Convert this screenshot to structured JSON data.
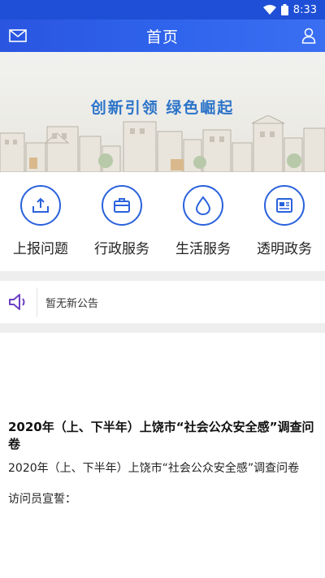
{
  "status_bar": {
    "time": "8:33"
  },
  "header": {
    "title": "首页"
  },
  "banner": {
    "slogan": "创新引领 绿色崛起"
  },
  "services": [
    {
      "label": "上报问题",
      "icon": "upload-tray-icon"
    },
    {
      "label": "行政服务",
      "icon": "briefcase-icon"
    },
    {
      "label": "生活服务",
      "icon": "water-drop-icon"
    },
    {
      "label": "透明政务",
      "icon": "newspaper-icon"
    }
  ],
  "notice": {
    "text": "暂无新公告"
  },
  "article": {
    "title": "2020年（上、下半年）上饶市“社会公众安全感”调查问卷",
    "body": "2020年（上、下半年）上饶市“社会公众安全感”调查问卷",
    "sub": "访问员宣誓："
  },
  "colors": {
    "primary": "#2a55e0",
    "slogan": "#2c74c9",
    "icon_border": "#2a62dc",
    "speaker": "#6b3fc6"
  }
}
